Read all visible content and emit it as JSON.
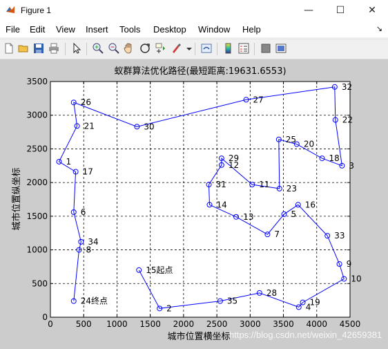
{
  "window": {
    "title": "Figure 1",
    "minimize_glyph": "—",
    "maximize_glyph": "☐",
    "close_glyph": "✕"
  },
  "menu": {
    "items": [
      "File",
      "Edit",
      "View",
      "Insert",
      "Tools",
      "Desktop",
      "Window",
      "Help"
    ],
    "overflow_glyph": "↘"
  },
  "toolbar": {
    "icons": [
      "new-figure-icon",
      "open-file-icon",
      "save-icon",
      "print-icon",
      "select-arrow-icon",
      "zoom-in-icon",
      "zoom-out-icon",
      "pan-hand-icon",
      "rotate-3d-icon",
      "data-cursor-icon",
      "brush-icon",
      "link-plot-icon",
      "colorbar-icon",
      "legend-icon",
      "hide-plot-tools-icon",
      "show-plot-tools-icon"
    ]
  },
  "colors": {
    "line": "#0000ff",
    "figure_bg": "#cccccc",
    "axes_bg": "#ffffff"
  },
  "chart_data": {
    "type": "line",
    "title": "蚁群算法优化路径(最短距离:19631.6553)",
    "xlabel": "城市位置横坐标",
    "ylabel": "城市位置纵坐标",
    "xlim": [
      0,
      4500
    ],
    "ylim": [
      0,
      3500
    ],
    "xticks": [
      0,
      500,
      1000,
      1500,
      2000,
      2500,
      3000,
      3500,
      4000,
      4500
    ],
    "yticks": [
      0,
      500,
      1000,
      1500,
      2000,
      2500,
      3000,
      3500
    ],
    "grid": true,
    "marker": "circle",
    "cities": [
      {
        "id": "1",
        "x": 130,
        "y": 2310
      },
      {
        "id": "2",
        "x": 1640,
        "y": 130
      },
      {
        "id": "3",
        "x": 4380,
        "y": 2250
      },
      {
        "id": "4",
        "x": 3730,
        "y": 150
      },
      {
        "id": "5",
        "x": 3510,
        "y": 1530
      },
      {
        "id": "6",
        "x": 350,
        "y": 1560
      },
      {
        "id": "7",
        "x": 3260,
        "y": 1230
      },
      {
        "id": "8",
        "x": 430,
        "y": 1000
      },
      {
        "id": "9",
        "x": 4340,
        "y": 790
      },
      {
        "id": "10",
        "x": 4410,
        "y": 570
      },
      {
        "id": "11",
        "x": 3030,
        "y": 1970
      },
      {
        "id": "12",
        "x": 2570,
        "y": 2260
      },
      {
        "id": "13",
        "x": 2790,
        "y": 1490
      },
      {
        "id": "14",
        "x": 2390,
        "y": 1670
      },
      {
        "id": "15起点",
        "x": 1330,
        "y": 700
      },
      {
        "id": "16",
        "x": 3720,
        "y": 1670
      },
      {
        "id": "17",
        "x": 380,
        "y": 2160
      },
      {
        "id": "18",
        "x": 4080,
        "y": 2360
      },
      {
        "id": "19",
        "x": 3790,
        "y": 220
      },
      {
        "id": "20",
        "x": 3700,
        "y": 2570
      },
      {
        "id": "21",
        "x": 400,
        "y": 2840
      },
      {
        "id": "22",
        "x": 4280,
        "y": 2930
      },
      {
        "id": "23",
        "x": 3440,
        "y": 1910
      },
      {
        "id": "24终点",
        "x": 350,
        "y": 240
      },
      {
        "id": "25",
        "x": 3430,
        "y": 2640
      },
      {
        "id": "26",
        "x": 350,
        "y": 3190
      },
      {
        "id": "27",
        "x": 2940,
        "y": 3230
      },
      {
        "id": "28",
        "x": 3140,
        "y": 360
      },
      {
        "id": "29",
        "x": 2570,
        "y": 2360
      },
      {
        "id": "30",
        "x": 1300,
        "y": 2830
      },
      {
        "id": "31",
        "x": 2380,
        "y": 1970
      },
      {
        "id": "32",
        "x": 4270,
        "y": 3420
      },
      {
        "id": "33",
        "x": 4160,
        "y": 1210
      },
      {
        "id": "34",
        "x": 460,
        "y": 1120
      },
      {
        "id": "35",
        "x": 2550,
        "y": 240
      }
    ],
    "route": [
      "15起点",
      "2",
      "35",
      "28",
      "4",
      "19",
      "10",
      "9",
      "33",
      "16",
      "5",
      "7",
      "13",
      "14",
      "31",
      "12",
      "29",
      "11",
      "23",
      "25",
      "20",
      "18",
      "3",
      "22",
      "32",
      "27",
      "30",
      "26",
      "21",
      "1",
      "17",
      "6",
      "34",
      "8",
      "24终点"
    ],
    "watermark": "https://blog.csdn.net/weixin_42659381"
  }
}
